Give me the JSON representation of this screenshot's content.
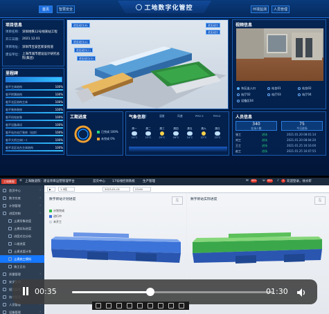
{
  "dashboard": {
    "title": "工地数字化管控",
    "nav_left": [
      "首页",
      "智慧安全"
    ],
    "nav_right": [
      "环境监测",
      "人员管理"
    ],
    "project_info": {
      "title": "项目信息",
      "rows": [
        {
          "label": "项目名称：",
          "value": "深圳地铁12号线某站工程"
        },
        {
          "label": "开工日期：",
          "value": "2021.12.01"
        },
        {
          "label": "项目地址：",
          "value": "深圳市宝安区新安街道"
        },
        {
          "label": "建设单位：",
          "value": "上海市城市建设设计研究总院(集团)"
        }
      ]
    },
    "milestones": {
      "title": "里程碑",
      "progress_label": "总进度",
      "progress": 100,
      "items": [
        {
          "label": "临平主体结构",
          "value": "100%",
          "pct": 100
        },
        {
          "label": "临平附属结构",
          "value": "100%",
          "pct": 100
        },
        {
          "label": "临平北区结构主体",
          "value": "100%",
          "pct": 100
        },
        {
          "label": "临平装饰装修",
          "value": "100%",
          "pct": 100
        },
        {
          "label": "临平机电安装",
          "value": "100%",
          "pct": 100
        },
        {
          "label": "临平设备调试",
          "value": "100%",
          "pct": 100
        },
        {
          "label": "临平站台站厅装修（站房）",
          "value": "100%",
          "pct": 100
        },
        {
          "label": "临平大桥主体(一)",
          "value": "100%",
          "pct": 100
        },
        {
          "label": "临平北区站台主体结构",
          "value": "100%",
          "pct": 100
        }
      ]
    },
    "scene": {
      "tags_left": [
        "进出站口(B)",
        "进出站口(A)",
        "进出站口(C)",
        "进出站口(D)"
      ],
      "tags_right": [
        "进出站口",
        "进出站口"
      ]
    },
    "camera": {
      "title": "视频信息",
      "options": [
        {
          "label": "东区出入口",
          "on": true
        },
        {
          "label": "站台01",
          "on": false
        },
        {
          "label": "站台02",
          "on": false
        },
        {
          "label": "站厅02",
          "on": false
        },
        {
          "label": "站厅03",
          "on": false
        },
        {
          "label": "站厅04",
          "on": false
        },
        {
          "label": "设备区04",
          "on": false
        }
      ]
    },
    "project_progress": {
      "title": "工期进度",
      "legend": [
        {
          "label": "已完成 100%",
          "color": "#2ad17a"
        },
        {
          "label": "未完成 0%",
          "color": "#f0a030"
        }
      ],
      "completed": 100
    },
    "weather": {
      "title": "气象信息",
      "metrics": [
        "温度",
        "湿度",
        "风速",
        "PM2.5",
        "PM10"
      ],
      "days": [
        {
          "day": "周一",
          "temp": "24°C",
          "sun": false
        },
        {
          "day": "周二",
          "temp": "23°C",
          "sun": false
        },
        {
          "day": "周三",
          "temp": "25°C",
          "sun": true
        },
        {
          "day": "周四",
          "temp": "26°C",
          "sun": false
        },
        {
          "day": "周五",
          "temp": "24°C",
          "sun": false
        },
        {
          "day": "周六",
          "temp": "22°C",
          "sun": true
        },
        {
          "day": "周日",
          "temp": "23°C",
          "sun": false
        }
      ]
    },
    "personnel": {
      "title": "人员信息",
      "stats": [
        {
          "label": "在场人数",
          "value": "340"
        },
        {
          "label": "今日进场",
          "value": "75"
        }
      ],
      "rows": [
        {
          "name": "张工",
          "status": "进场",
          "time": "2021.01.20 08:01:14"
        },
        {
          "name": "刘工",
          "status": "进场",
          "time": "2021.01.20 08:04:20"
        },
        {
          "name": "王工",
          "status": "进场",
          "time": "2021.01.25 16:16:00"
        },
        {
          "name": "赵工",
          "status": "进场",
          "time": "2021.01.25 16:07:55"
        }
      ]
    }
  },
  "app": {
    "logo": "工地数智",
    "breadcrumb": [
      "上海隧道院 · 建设项目运营管理平台",
      "首页中心",
      "17号线控测系统",
      "生产管理"
    ],
    "badges": [
      "99+",
      "99+",
      "1"
    ],
    "user": "欢迎登录，徐文轩",
    "sidebar": [
      {
        "label": "首页中心",
        "sub": false,
        "active": false
      },
      {
        "label": "数字交底",
        "sub": false,
        "active": false
      },
      {
        "label": "计划管理",
        "sub": false,
        "active": false
      },
      {
        "label": "进度控制",
        "sub": false,
        "active": false
      },
      {
        "label": "土建形象进度",
        "sub": true,
        "active": false
      },
      {
        "label": "土建实际进度",
        "sub": true,
        "active": false
      },
      {
        "label": "进度对比分析",
        "sub": true,
        "active": false
      },
      {
        "label": "二维进度",
        "sub": true,
        "active": false
      },
      {
        "label": "土建进度计划",
        "sub": true,
        "active": false
      },
      {
        "label": "土建施工模拟",
        "sub": true,
        "active": true
      },
      {
        "label": "施工日志",
        "sub": true,
        "active": false
      },
      {
        "label": "质量管理",
        "sub": false,
        "active": false
      },
      {
        "label": "安全管理",
        "sub": false,
        "active": false
      },
      {
        "label": "投资管理",
        "sub": false,
        "active": false
      },
      {
        "label": "技术管理",
        "sub": false,
        "active": false
      },
      {
        "label": "人员管理",
        "sub": false,
        "active": false
      },
      {
        "label": "设备管理",
        "sub": false,
        "active": false
      }
    ],
    "toolbar": {
      "speed": "1.5倍",
      "date": "2023-01-01",
      "time": "23:00"
    },
    "left_view": {
      "title": "数字新站计划进度",
      "legend": [
        {
          "label": "计划完成",
          "color": "#2fbf46"
        },
        {
          "label": "进行中",
          "color": "#3a6fe0"
        },
        {
          "label": "未开工",
          "color": "#cfd6de"
        }
      ],
      "corner": "左"
    },
    "right_view": {
      "title": "数字新站实际进度",
      "corner": "左"
    },
    "player": {
      "current": "00:35",
      "total": "01:30",
      "progress": 0.39
    }
  }
}
